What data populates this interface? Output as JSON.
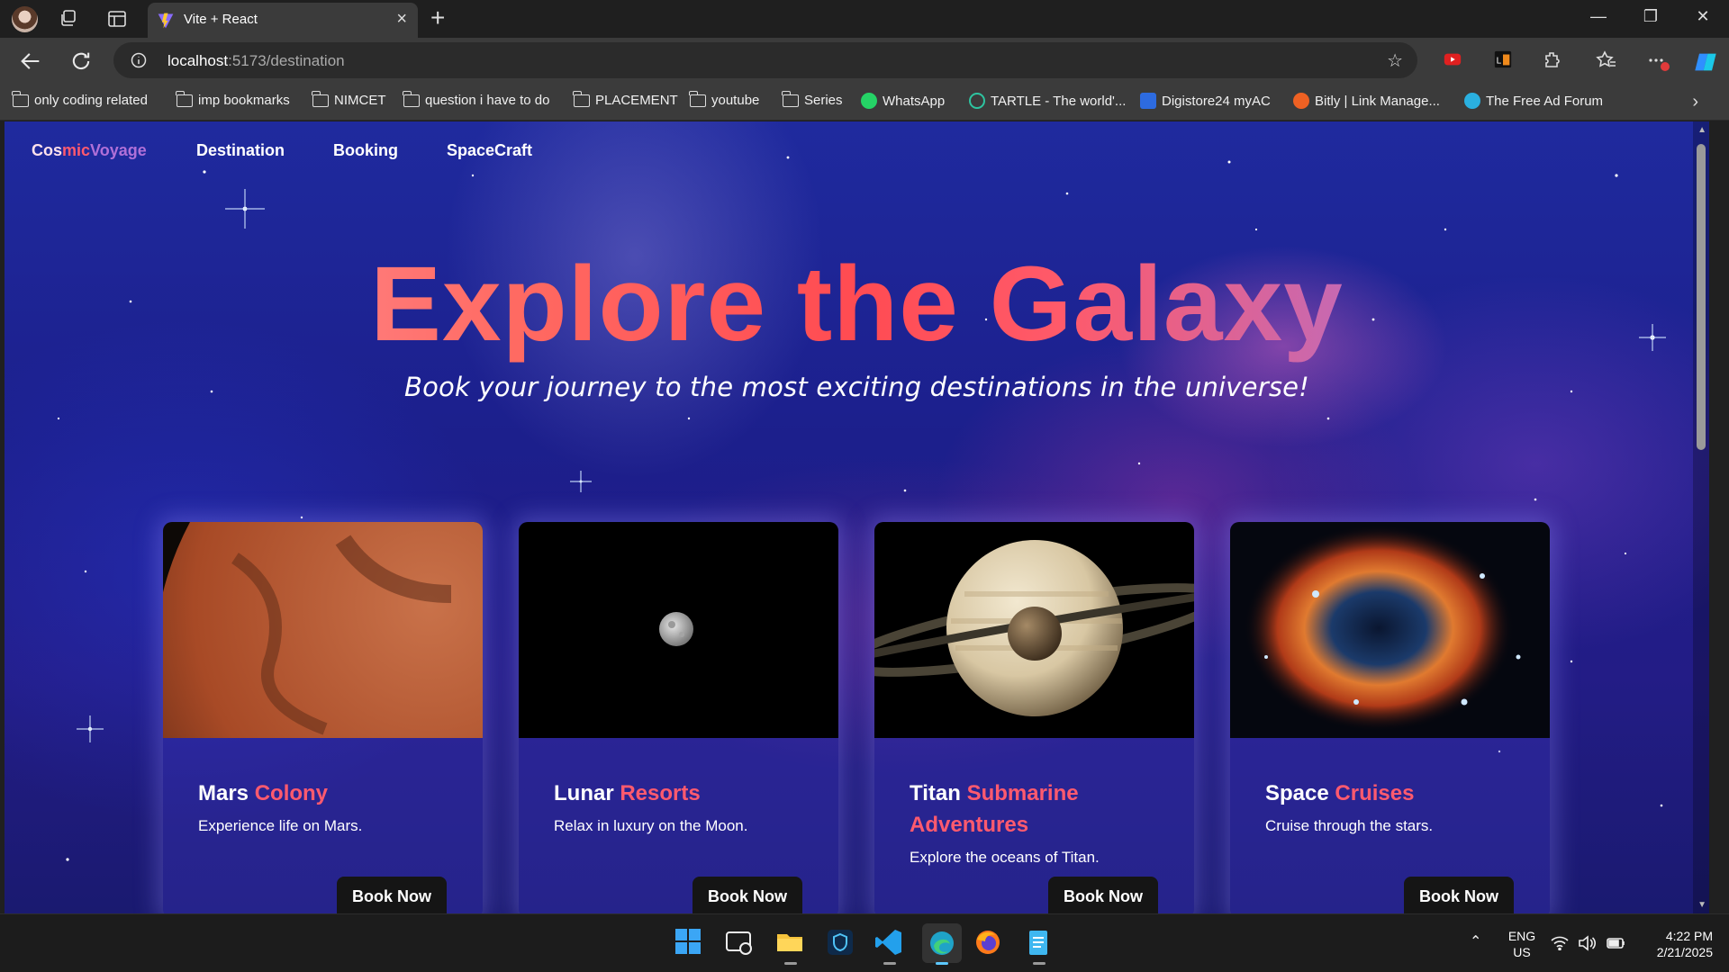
{
  "browser": {
    "tab_title": "Vite + React",
    "url_host": "localhost",
    "url_path": ":5173/destination",
    "bookmarks": [
      {
        "label": "only coding  related",
        "type": "folder"
      },
      {
        "label": "imp bookmarks",
        "type": "folder"
      },
      {
        "label": "NIMCET",
        "type": "folder"
      },
      {
        "label": "question i have to do",
        "type": "folder"
      },
      {
        "label": "PLACEMENT",
        "type": "folder"
      },
      {
        "label": "youtube",
        "type": "folder"
      },
      {
        "label": "Series",
        "type": "folder"
      },
      {
        "label": "WhatsApp",
        "type": "site"
      },
      {
        "label": "TARTLE - The world'...",
        "type": "site"
      },
      {
        "label": "Digistore24 myAC",
        "type": "site"
      },
      {
        "label": "Bitly | Link Manage...",
        "type": "site"
      },
      {
        "label": "The Free Ad Forum",
        "type": "site"
      }
    ]
  },
  "site": {
    "logo": {
      "part1": "Cos",
      "part2": "mic",
      "part3": "Voyage"
    },
    "nav": [
      "Destination",
      "Booking",
      "SpaceCraft"
    ],
    "hero_title": "Explore the Galaxy",
    "hero_subtitle": "Book your journey to the most exciting destinations in the universe!",
    "cards": [
      {
        "title_a": "Mars ",
        "title_b": "Colony",
        "desc": "Experience life on Mars.",
        "button": "Book Now"
      },
      {
        "title_a": "Lunar ",
        "title_b": "Resorts",
        "desc": "Relax in luxury on the Moon.",
        "button": "Book Now"
      },
      {
        "title_a": "Titan ",
        "title_b": "Submarine Adventures",
        "desc": "Explore the oceans of Titan.",
        "button": "Book Now"
      },
      {
        "title_a": "Space ",
        "title_b": "Cruises",
        "desc": "Cruise through the stars.",
        "button": "Book Now"
      }
    ]
  },
  "taskbar": {
    "lang_line1": "ENG",
    "lang_line2": "US",
    "time": "4:22 PM",
    "date": "2/21/2025"
  },
  "colors": {
    "accent_red": "#ff5a6e",
    "accent_purple": "#b070d8",
    "page_bg": "#1f2a9e"
  }
}
